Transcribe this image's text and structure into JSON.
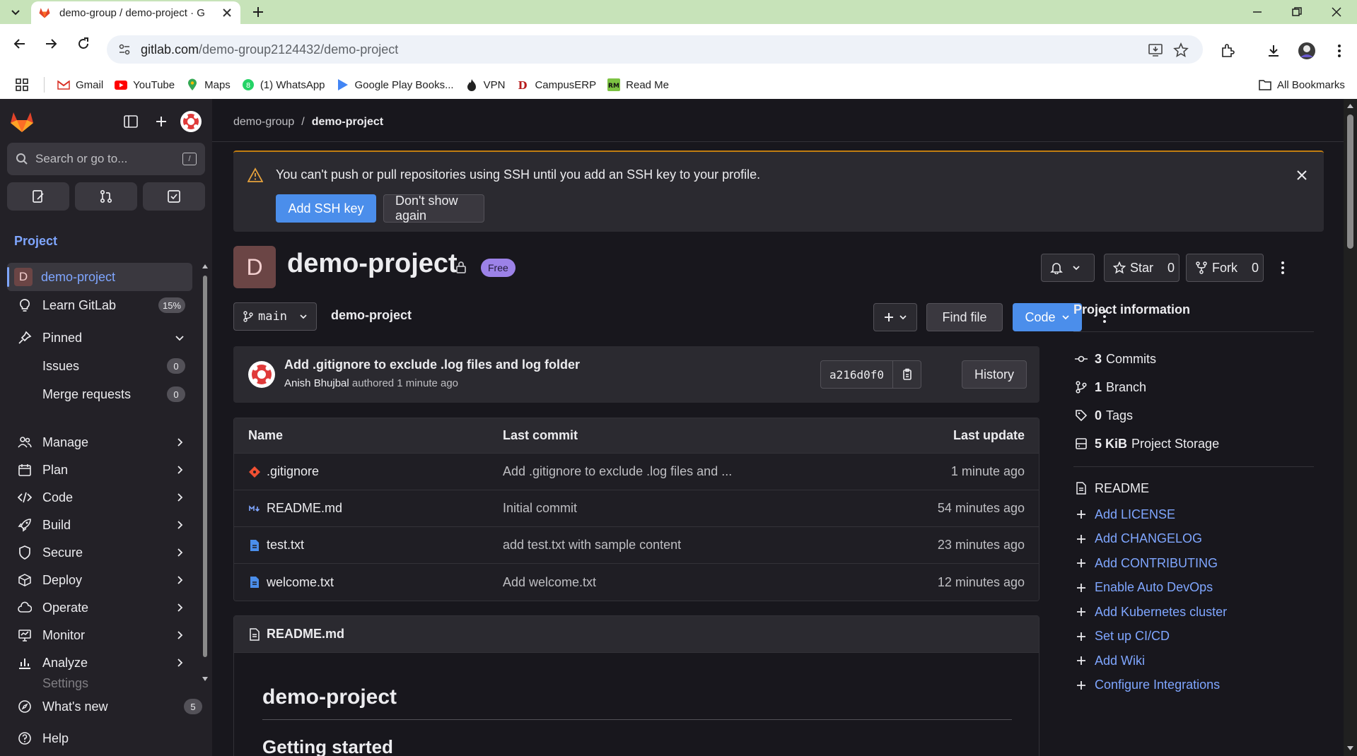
{
  "browser": {
    "tab_title": "demo-group / demo-project · G",
    "url_host": "gitlab.com",
    "url_path": "/demo-group2124432/demo-project",
    "bookmarks": [
      {
        "label": "Gmail",
        "icon": "gmail-icon"
      },
      {
        "label": "YouTube",
        "icon": "youtube-icon"
      },
      {
        "label": "Maps",
        "icon": "maps-icon"
      },
      {
        "label": "(1) WhatsApp",
        "icon": "whatsapp-icon"
      },
      {
        "label": "Google Play Books...",
        "icon": "play-books-icon"
      },
      {
        "label": "VPN",
        "icon": "vpn-icon"
      },
      {
        "label": "CampusERP",
        "icon": "campuserp-icon"
      },
      {
        "label": "Read Me",
        "icon": "readme-icon"
      }
    ],
    "all_bookmarks": "All Bookmarks"
  },
  "sidebar": {
    "search_placeholder": "Search or go to...",
    "search_shortcut": "/",
    "section_label": "Project",
    "project_initial": "D",
    "project_name": "demo-project",
    "learn_label": "Learn GitLab",
    "learn_badge": "15%",
    "pinned_label": "Pinned",
    "issues_label": "Issues",
    "issues_count": "0",
    "mr_label": "Merge requests",
    "mr_count": "0",
    "nav": [
      {
        "label": "Manage"
      },
      {
        "label": "Plan"
      },
      {
        "label": "Code"
      },
      {
        "label": "Build"
      },
      {
        "label": "Secure"
      },
      {
        "label": "Deploy"
      },
      {
        "label": "Operate"
      },
      {
        "label": "Monitor"
      },
      {
        "label": "Analyze"
      }
    ],
    "settings_label": "Settings",
    "whats_new_label": "What's new",
    "whats_new_count": "5",
    "help_label": "Help"
  },
  "breadcrumb": {
    "group": "demo-group",
    "project": "demo-project"
  },
  "alert": {
    "message": "You can't push or pull repositories using SSH until you add an SSH key to your profile.",
    "primary_btn": "Add SSH key",
    "secondary_btn": "Don't show again"
  },
  "project": {
    "initial": "D",
    "title": "demo-project",
    "badge": "Free",
    "star_label": "Star",
    "star_count": "0",
    "fork_label": "Fork",
    "fork_count": "0"
  },
  "repo": {
    "branch": "main",
    "path": "demo-project",
    "find_file": "Find file",
    "code_btn": "Code"
  },
  "last_commit": {
    "title": "Add .gitignore to exclude .log files and log folder",
    "author": "Anish Bhujbal",
    "action": "authored",
    "time": "1 minute ago",
    "sha": "a216d0f0",
    "history": "History"
  },
  "file_table": {
    "headers": [
      "Name",
      "Last commit",
      "Last update"
    ],
    "rows": [
      {
        "name": ".gitignore",
        "commit": "Add .gitignore to exclude .log files and ...",
        "updated": "1 minute ago",
        "icon": "gitignore-icon"
      },
      {
        "name": "README.md",
        "commit": "Initial commit",
        "updated": "54 minutes ago",
        "icon": "markdown-icon"
      },
      {
        "name": "test.txt",
        "commit": "add test.txt with sample content",
        "updated": "23 minutes ago",
        "icon": "text-file-icon"
      },
      {
        "name": "welcome.txt",
        "commit": "Add welcome.txt",
        "updated": "12 minutes ago",
        "icon": "text-file-icon"
      }
    ]
  },
  "readme": {
    "filename": "README.md",
    "h1": "demo-project",
    "h2": "Getting started"
  },
  "project_info": {
    "title": "Project information",
    "stats": [
      {
        "value": "3",
        "label": "Commits"
      },
      {
        "value": "1",
        "label": "Branch"
      },
      {
        "value": "0",
        "label": "Tags"
      },
      {
        "value": "5 KiB",
        "label": "Project Storage"
      }
    ],
    "readme_label": "README",
    "links": [
      "Add LICENSE",
      "Add CHANGELOG",
      "Add CONTRIBUTING",
      "Enable Auto DevOps",
      "Add Kubernetes cluster",
      "Set up CI/CD",
      "Add Wiki",
      "Configure Integrations"
    ]
  },
  "colors": {
    "accent_blue": "#4b8eeb",
    "sidebar_bg": "#232127",
    "main_bg": "#18171d",
    "warning": "#c17d10",
    "free_badge": "#9c82e8"
  }
}
